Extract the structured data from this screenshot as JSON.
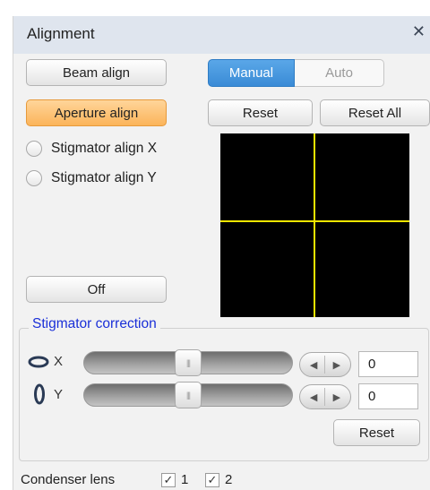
{
  "window": {
    "title": "Alignment",
    "close_icon": "close-icon"
  },
  "align_buttons": {
    "beam": "Beam align",
    "aperture": "Aperture align",
    "stigmator_x": "Stigmator align X",
    "stigmator_y": "Stigmator align Y",
    "off": "Off"
  },
  "mode": {
    "manual": "Manual",
    "auto": "Auto",
    "selected": "Manual"
  },
  "actions": {
    "reset": "Reset",
    "reset_all": "Reset All"
  },
  "stigmator": {
    "title": "Stigmator correction",
    "x": {
      "label": "X",
      "value": "0",
      "slider_level": 0.5
    },
    "y": {
      "label": "Y",
      "value": "0",
      "slider_level": 0.5
    },
    "reset": "Reset"
  },
  "condenser": {
    "label": "Condenser lens",
    "lens1": {
      "label": "1",
      "checked": true
    },
    "lens2": {
      "label": "2",
      "checked": true
    }
  },
  "colors": {
    "accent_blue": "#3a8bd6",
    "active_orange": "#fbb45a",
    "crosshair_yellow": "#f2e600",
    "group_title_blue": "#1a2fd8"
  }
}
